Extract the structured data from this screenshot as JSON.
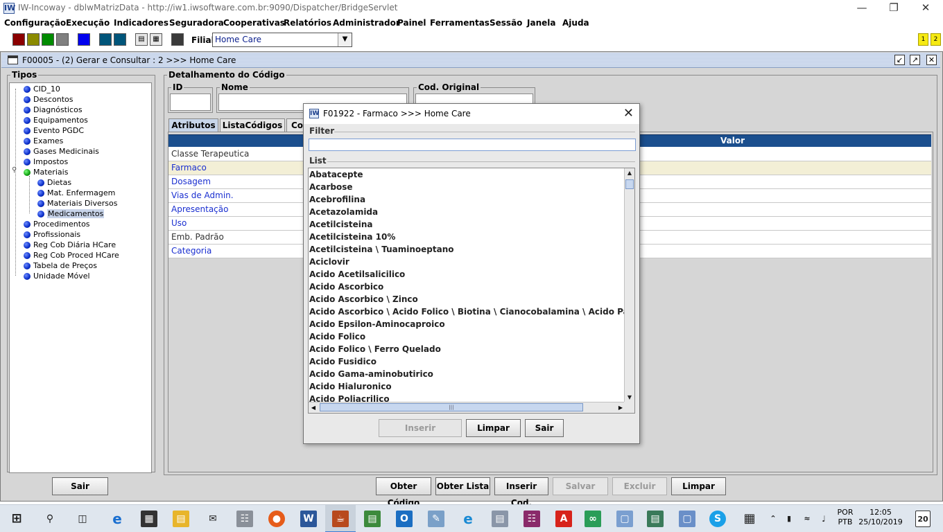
{
  "window": {
    "title": "IW-Incoway - dblwMatrizData - http://iw1.iwsoftware.com.br:9090/Dispatcher/BridgeServlet",
    "app_icon": "IW"
  },
  "menu": [
    "Configuração",
    "Execução",
    "Indicadores",
    "Seguradora",
    "Cooperativas",
    "Relatórios",
    "Administrador",
    "Painel",
    "Ferramentas",
    "Sessão",
    "Janela",
    "Ajuda"
  ],
  "toolbar": {
    "swatches": [
      "#8b0000",
      "#8b8b00",
      "#008b00",
      "#808080",
      "#0000ee",
      "#00557a",
      "#00557a"
    ],
    "filial_label": "Filial:",
    "filial_value": "Home Care",
    "badges": [
      "1",
      "2"
    ]
  },
  "frame": {
    "title": "F00005 - (2) Gerar e Consultar : 2 >>> Home Care",
    "controls": [
      "restore-icon",
      "maximize-icon",
      "close-icon"
    ]
  },
  "tipos": {
    "label": "Tipos",
    "items": [
      "CID_10",
      "Descontos",
      "Diagnósticos",
      "Equipamentos",
      "Evento PGDC",
      "Exames",
      "Gases Medicinais",
      "Impostos",
      "Materiais"
    ],
    "materiais_children": [
      "Dietas",
      "Mat. Enfermagem",
      "Materiais Diversos",
      "Medicamentos"
    ],
    "items_after": [
      "Procedimentos",
      "Profissionais",
      "Reg Cob Diária HCare",
      "Reg Cob Proced HCare",
      "Tabela de Preços",
      "Unidade Móvel"
    ],
    "sair": "Sair"
  },
  "detalhe": {
    "label": "Detalhamento do Código",
    "id_label": "ID",
    "nome_label": "Nome",
    "cod_original_label": "Cod. Original",
    "tabs": [
      "Atributos",
      "ListaCódigos",
      "Co"
    ],
    "table_header_value": "Valor",
    "rows": [
      {
        "key": "Classe Terapeutica",
        "style": "plain"
      },
      {
        "key": "Farmaco",
        "style": "link"
      },
      {
        "key": "Dosagem",
        "style": "link"
      },
      {
        "key": "Vias de Admin.",
        "style": "link"
      },
      {
        "key": "Apresentação",
        "style": "link"
      },
      {
        "key": "Uso",
        "style": "link"
      },
      {
        "key": "Emb. Padrão",
        "style": "plain"
      },
      {
        "key": "Categoria",
        "style": "link"
      }
    ],
    "buttons": [
      {
        "label": "Obter Código",
        "enabled": true
      },
      {
        "label": "Obter Lista",
        "enabled": true
      },
      {
        "label": "Inserir Cod.",
        "enabled": true
      },
      {
        "label": "Salvar",
        "enabled": false
      },
      {
        "label": "Excluir",
        "enabled": false
      },
      {
        "label": "Limpar",
        "enabled": true
      }
    ]
  },
  "dialog": {
    "title": "F01922 - Farmaco >>> Home Care",
    "filter_label": "Filter",
    "filter_value": "",
    "list_label": "List",
    "items": [
      "Abatacepte",
      "Acarbose",
      "Acebrofilina",
      "Acetazolamida",
      "Acetilcisteina",
      "Acetilcisteina 10%",
      "Acetilcisteina \\ Tuaminoeptano",
      "Aciclovir",
      "Acido Acetilsalicilico",
      "Acido Ascorbico",
      "Acido Ascorbico \\  Zinco",
      "Acido Ascorbico \\ Acido Folico \\ Biotina \\ Cianocobalamina \\ Acido Pantotenico \\ R",
      "Acido Epsilon-Aminocaproico",
      "Acido Folico",
      "Acido Folico \\ Ferro Quelado",
      "Acido Fusidico",
      "Acido Gama-aminobutirico",
      "Acido Hialuronico",
      "Acido Poliacrilico"
    ],
    "buttons": [
      {
        "label": "Inserir",
        "enabled": false
      },
      {
        "label": "Limpar",
        "enabled": true
      },
      {
        "label": "Sair",
        "enabled": true
      }
    ]
  },
  "taskbar": {
    "icons": [
      "windows-start-icon",
      "search-icon",
      "task-view-icon",
      "edge-icon",
      "store-icon",
      "file-explorer-icon",
      "mail-icon",
      "network-app-icon",
      "firefox-icon",
      "word-icon",
      "java-icon",
      "project-icon",
      "outlook-icon",
      "notes-icon",
      "ie-icon",
      "monitor-icon",
      "winrar-icon",
      "acrobat-icon",
      "visual-studio-icon",
      "box-icon",
      "document-app-icon",
      "box-icon-2",
      "skype-icon",
      "calculator-icon"
    ],
    "lang_top": "POR",
    "lang_bottom": "PTB",
    "time": "12:05",
    "date": "25/10/2019",
    "notification_count": "20"
  }
}
